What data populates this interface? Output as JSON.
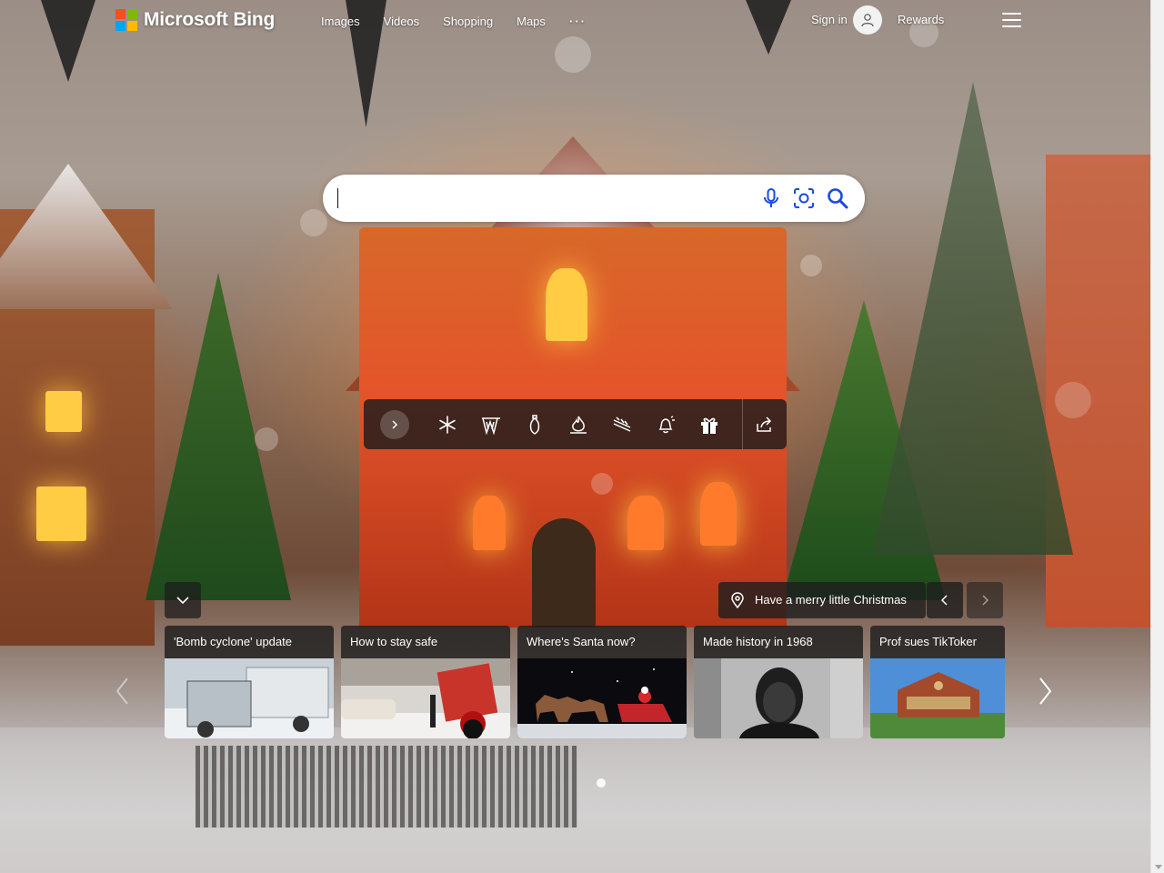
{
  "header": {
    "logo_text": "Microsoft Bing",
    "logo_colors": [
      "#f25022",
      "#7fba00",
      "#00a4ef",
      "#ffb900"
    ],
    "nav": [
      "Images",
      "Videos",
      "Shopping",
      "Maps",
      "···"
    ],
    "signin_label": "Sign in",
    "rewards_label": "Rewards",
    "menu_icon": "hamburger-menu-icon"
  },
  "search": {
    "value": "",
    "placeholder": "",
    "icons": [
      "microphone-icon",
      "visual-search-icon",
      "search-icon"
    ],
    "icon_color": "#174ae4"
  },
  "toolbar": {
    "icons": [
      "expand-arrow-icon",
      "snowflake-icon",
      "mountains-icon",
      "ornament-icon",
      "flame-icon",
      "ski-trail-icon",
      "bell-icon",
      "gift-icon",
      "share-icon"
    ]
  },
  "caption": {
    "text": "Have a merry little Christmas"
  },
  "news": [
    {
      "title": "'Bomb cyclone' update"
    },
    {
      "title": "How to stay safe"
    },
    {
      "title": "Where's Santa now?"
    },
    {
      "title": "Made history in 1968"
    },
    {
      "title": "Prof sues TikToker"
    }
  ]
}
